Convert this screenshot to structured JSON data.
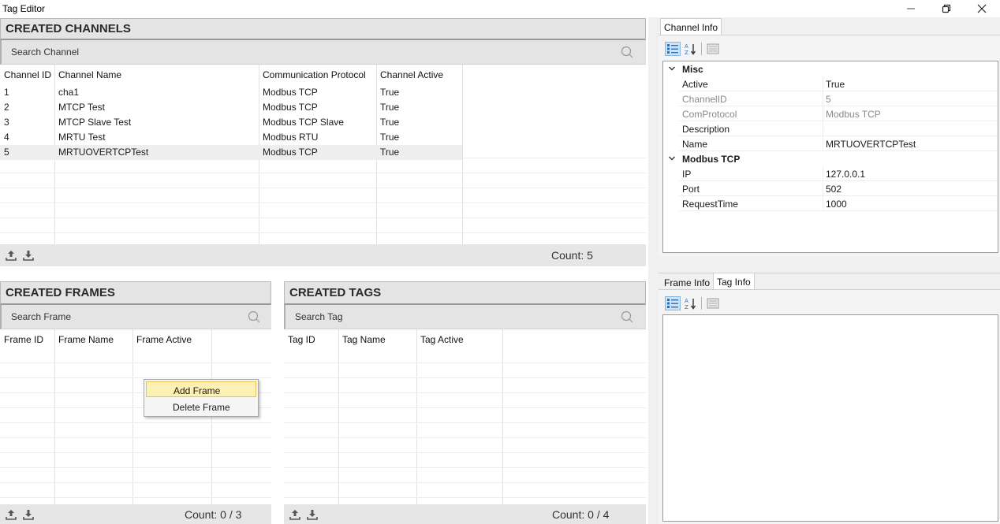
{
  "window": {
    "title": "Tag Editor"
  },
  "channels": {
    "title": "CREATED CHANNELS",
    "search_placeholder": "Search Channel",
    "columns": [
      "Channel ID",
      "Channel Name",
      "Communication Protocol",
      "Channel Active"
    ],
    "rows": [
      [
        "1",
        "cha1",
        "Modbus TCP",
        "True"
      ],
      [
        "2",
        "MTCP Test",
        "Modbus TCP",
        "True"
      ],
      [
        "3",
        "MTCP Slave Test",
        "Modbus TCP Slave",
        "True"
      ],
      [
        "4",
        "MRTU Test",
        "Modbus RTU",
        "True"
      ],
      [
        "5",
        "MRTUOVERTCPTest",
        "Modbus TCP",
        "True"
      ]
    ],
    "selected_row": 4,
    "count": "Count: 5"
  },
  "frames": {
    "title": "CREATED FRAMES",
    "search_placeholder": "Search Frame",
    "columns": [
      "Frame ID",
      "Frame Name",
      "Frame Active"
    ],
    "count": "Count: 0 / 3"
  },
  "tags": {
    "title": "CREATED TAGS",
    "search_placeholder": "Search Tag",
    "columns": [
      "Tag ID",
      "Tag Name",
      "Tag Active"
    ],
    "count": "Count: 0 / 4"
  },
  "context_menu": {
    "items": [
      "Add Frame",
      "Delete Frame"
    ],
    "highlighted": 0
  },
  "channel_info": {
    "tab": "Channel Info",
    "categories": [
      {
        "name": "Misc",
        "props": [
          {
            "key": "Active",
            "value": "True",
            "readonly": false
          },
          {
            "key": "ChannelID",
            "value": "5",
            "readonly": true
          },
          {
            "key": "ComProtocol",
            "value": "Modbus TCP",
            "readonly": true
          },
          {
            "key": "Description",
            "value": "",
            "readonly": false
          },
          {
            "key": "Name",
            "value": "MRTUOVERTCPTest",
            "readonly": false
          }
        ]
      },
      {
        "name": "Modbus TCP",
        "props": [
          {
            "key": "IP",
            "value": "127.0.0.1",
            "readonly": false
          },
          {
            "key": "Port",
            "value": "502",
            "readonly": false
          },
          {
            "key": "RequestTime",
            "value": "1000",
            "readonly": false
          }
        ]
      }
    ]
  },
  "lower_info": {
    "tabs": [
      "Frame Info",
      "Tag Info"
    ],
    "active_tab": 1
  },
  "colors": {
    "panel_bg": "#e4e4e4",
    "selected_toolbar": "#cde4f7",
    "menu_highlight": "#fdf0b4"
  }
}
